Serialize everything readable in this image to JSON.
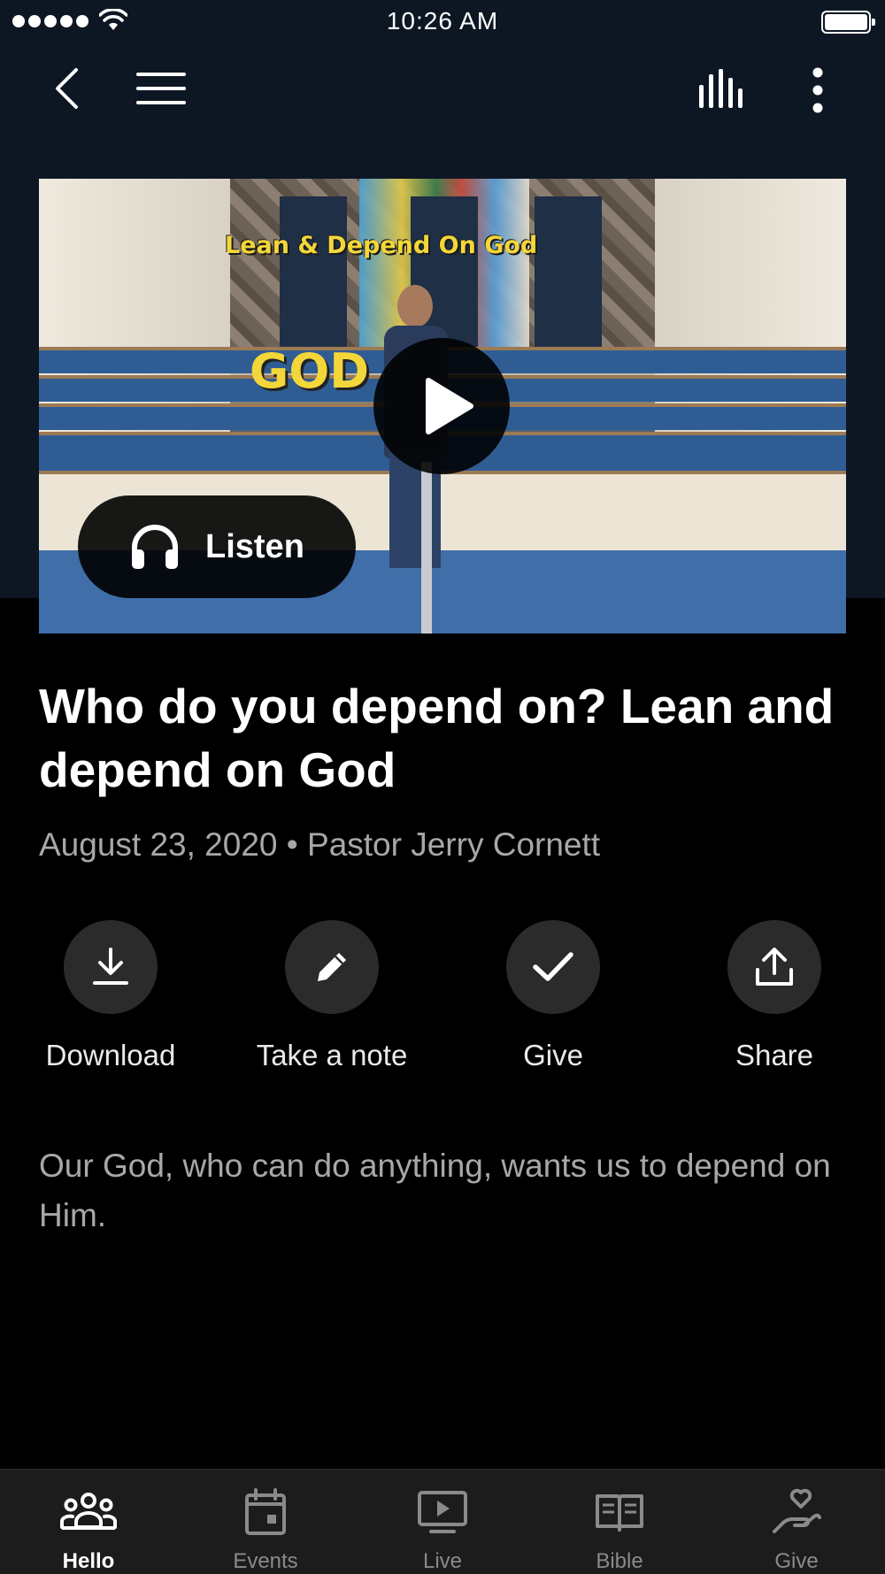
{
  "status_bar": {
    "time": "10:26 AM"
  },
  "nav": {
    "back_icon": "chevron-left-icon",
    "menu_icon": "hamburger-menu-icon",
    "audio_icon": "audio-bars-icon",
    "more_icon": "more-vertical-icon"
  },
  "video": {
    "overlay_title": "Lean & Depend On God",
    "overlay_word": "GOD",
    "play_icon": "play-icon",
    "listen_label": "Listen",
    "listen_icon": "headphones-icon"
  },
  "sermon": {
    "title": "Who do you depend on? Lean and depend on God",
    "meta": "August 23, 2020 • Pastor Jerry Cornett",
    "description": "Our God, who can do anything, wants us to depend on Him."
  },
  "actions": [
    {
      "label": "Download",
      "icon": "download-icon"
    },
    {
      "label": "Take a note",
      "icon": "pencil-icon"
    },
    {
      "label": "Give",
      "icon": "checkmark-icon"
    },
    {
      "label": "Share",
      "icon": "share-icon"
    }
  ],
  "tabs": [
    {
      "label": "Hello",
      "icon": "people-icon",
      "active": true
    },
    {
      "label": "Events",
      "icon": "calendar-icon",
      "active": false
    },
    {
      "label": "Live",
      "icon": "tv-play-icon",
      "active": false
    },
    {
      "label": "Bible",
      "icon": "open-book-icon",
      "active": false
    },
    {
      "label": "Give",
      "icon": "heart-hand-icon",
      "active": false
    }
  ],
  "colors": {
    "header_background": "#0d1724",
    "background": "#000000",
    "action_circle": "#2b2b2b",
    "secondary_text": "#a8a8a8",
    "tab_bar_background": "#1c1c1c"
  }
}
